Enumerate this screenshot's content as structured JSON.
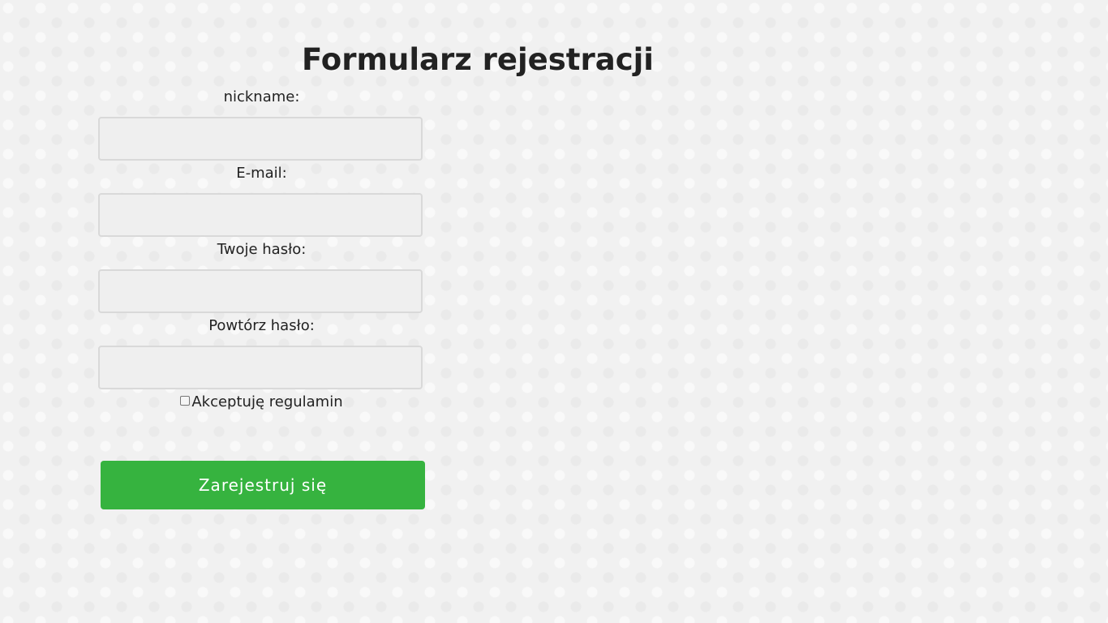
{
  "page": {
    "title": "Formularz rejestracji"
  },
  "form": {
    "fields": [
      {
        "label": "nickname:",
        "value": ""
      },
      {
        "label": "E-mail:",
        "value": ""
      },
      {
        "label": "Twoje hasło:",
        "value": ""
      },
      {
        "label": "Powtórz hasło:",
        "value": ""
      }
    ],
    "checkbox_label": "Akceptuję regulamin",
    "submit_label": "Zarejestruj się"
  },
  "colors": {
    "submit": "#36b33f",
    "background": "#f1f1f1"
  },
  "icons": {
    "checkbox": "checkbox-icon"
  }
}
